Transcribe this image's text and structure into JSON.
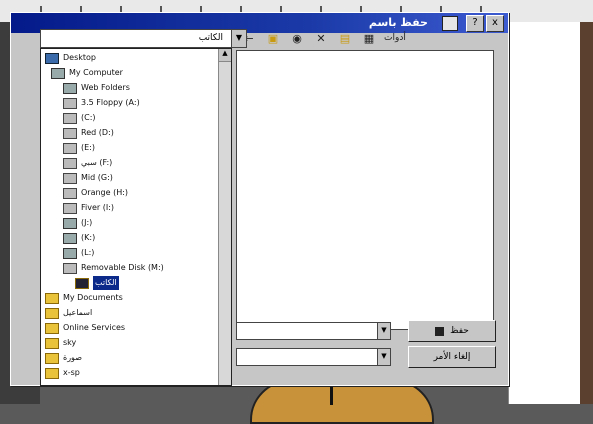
{
  "dialog": {
    "title": "حفظ باسم",
    "title_buttons": [
      "?",
      "x"
    ]
  },
  "location_combo": {
    "value": "الكاتب"
  },
  "toolbar": {
    "views_label": "أدوات"
  },
  "tree": {
    "items": [
      {
        "label": "Desktop",
        "icon": "desktop-icon"
      },
      {
        "label": "My Computer",
        "icon": "computer-icon"
      },
      {
        "label": "Web Folders",
        "icon": "web-folders-icon"
      },
      {
        "label": "3.5 Floppy (A:)",
        "icon": "floppy-icon"
      },
      {
        "label": "(C:)",
        "icon": "drive-icon"
      },
      {
        "label": "Red (D:)",
        "icon": "drive-icon"
      },
      {
        "label": "(E:)",
        "icon": "drive-icon"
      },
      {
        "label": "سبي (F:)",
        "icon": "drive-icon"
      },
      {
        "label": "Mid (G:)",
        "icon": "drive-icon"
      },
      {
        "label": "Orange (H:)",
        "icon": "drive-icon"
      },
      {
        "label": "Fiver (I:)",
        "icon": "drive-icon"
      },
      {
        "label": "(J:)",
        "icon": "cd-icon"
      },
      {
        "label": "(K:)",
        "icon": "cd-icon"
      },
      {
        "label": "(L:)",
        "icon": "cd-icon"
      },
      {
        "label": "Removable Disk (M:)",
        "icon": "removable-disk-icon"
      },
      {
        "label": "الكاتب",
        "icon": "folder-icon",
        "selected": true
      },
      {
        "label": "My Documents",
        "icon": "folder-icon"
      },
      {
        "label": "اسماعيل",
        "icon": "folder-icon"
      },
      {
        "label": "Online Services",
        "icon": "folder-icon"
      },
      {
        "label": "sky",
        "icon": "folder-icon"
      },
      {
        "label": "صورة",
        "icon": "folder-icon"
      },
      {
        "label": "x-sp",
        "icon": "folder-icon"
      }
    ]
  },
  "buttons": {
    "save_label": "حفظ",
    "cancel_label": "إلغاء الأمر"
  },
  "colors": {
    "titlebar": "#041a8a",
    "dialog_face": "#c6c6c6",
    "selection": "#0b2a8a"
  }
}
